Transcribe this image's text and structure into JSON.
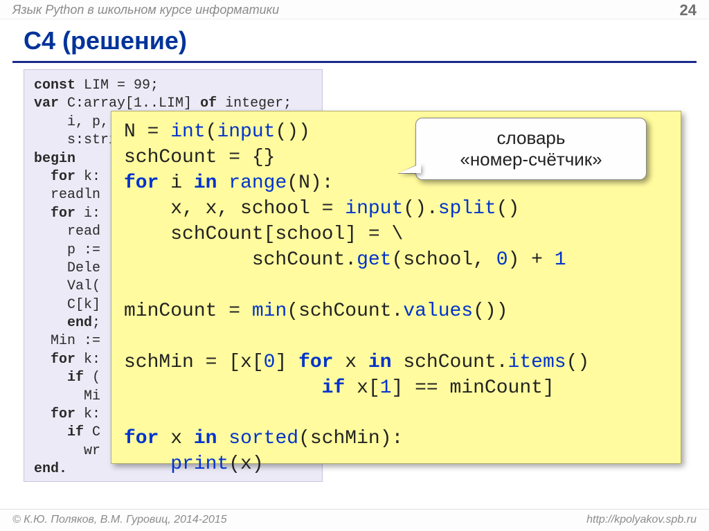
{
  "header": {
    "course": "Язык Python в школьном курсе информатики",
    "page": "24"
  },
  "title": "C4 (решение)",
  "callout": "словарь\n«номер-счётчик»",
  "pascal": {
    "l01a": "const",
    "l01b": " LIM = 99;",
    "l02a": "var",
    "l02b": " C:array[1..LIM] ",
    "l02c": "of",
    "l02d": " integer;",
    "l03": "    i, p, ",
    "l04": "    s:stri",
    "l05": "begin",
    "l06a": "  ",
    "l06b": "for",
    "l06c": " k:",
    "l07": "  readln",
    "l08a": "  ",
    "l08b": "for",
    "l08c": " i:",
    "l09": "    read",
    "l10": "    p :=",
    "l11": "    Dele",
    "l12": "    Val(",
    "l13": "    C[k]",
    "l14a": "    ",
    "l14b": "end",
    "l14c": ";",
    "l15": "  Min :=",
    "l16a": "  ",
    "l16b": "for",
    "l16c": " k:",
    "l17a": "    ",
    "l17b": "if",
    "l17c": " (",
    "l18": "      Mi",
    "l19a": "  ",
    "l19b": "for",
    "l19c": " k:",
    "l20a": "    ",
    "l20b": "if",
    "l20c": " C",
    "l21": "      wr",
    "l22": "end."
  },
  "python": {
    "t01": "N = ",
    "t01b": "int",
    "t01c": "(",
    "t01d": "input",
    "t01e": "())",
    "t02": "schCount = {}",
    "t03a": "for",
    "t03b": " i ",
    "t03c": "in",
    "t03d": " ",
    "t03e": "range",
    "t03f": "(N):",
    "t04a": "    x, x, school = ",
    "t04b": "input",
    "t04c": "().",
    "t04d": "split",
    "t04e": "()",
    "t05": "    schCount[school] = \\",
    "t06a": "           schCount.",
    "t06b": "get",
    "t06c": "(school, ",
    "t06d": "0",
    "t06e": ") + ",
    "t06f": "1",
    "t07a": "minCount = ",
    "t07b": "min",
    "t07c": "(schCount.",
    "t07d": "values",
    "t07e": "())",
    "t08a": "schMin = [x[",
    "t08b": "0",
    "t08c": "] ",
    "t08d": "for",
    "t08e": " x ",
    "t08f": "in",
    "t08g": " schCount.",
    "t08h": "items",
    "t08i": "()",
    "t09a": "                 ",
    "t09b": "if",
    "t09c": " x[",
    "t09d": "1",
    "t09e": "] == minCount]",
    "t10a": "for",
    "t10b": " x ",
    "t10c": "in",
    "t10d": " ",
    "t10e": "sorted",
    "t10f": "(schMin):",
    "t11a": "    ",
    "t11b": "print",
    "t11c": "(x)"
  },
  "footer": {
    "left": "© К.Ю. Поляков, В.М. Гуровиц, 2014-2015",
    "right": "http://kpolyakov.spb.ru"
  }
}
